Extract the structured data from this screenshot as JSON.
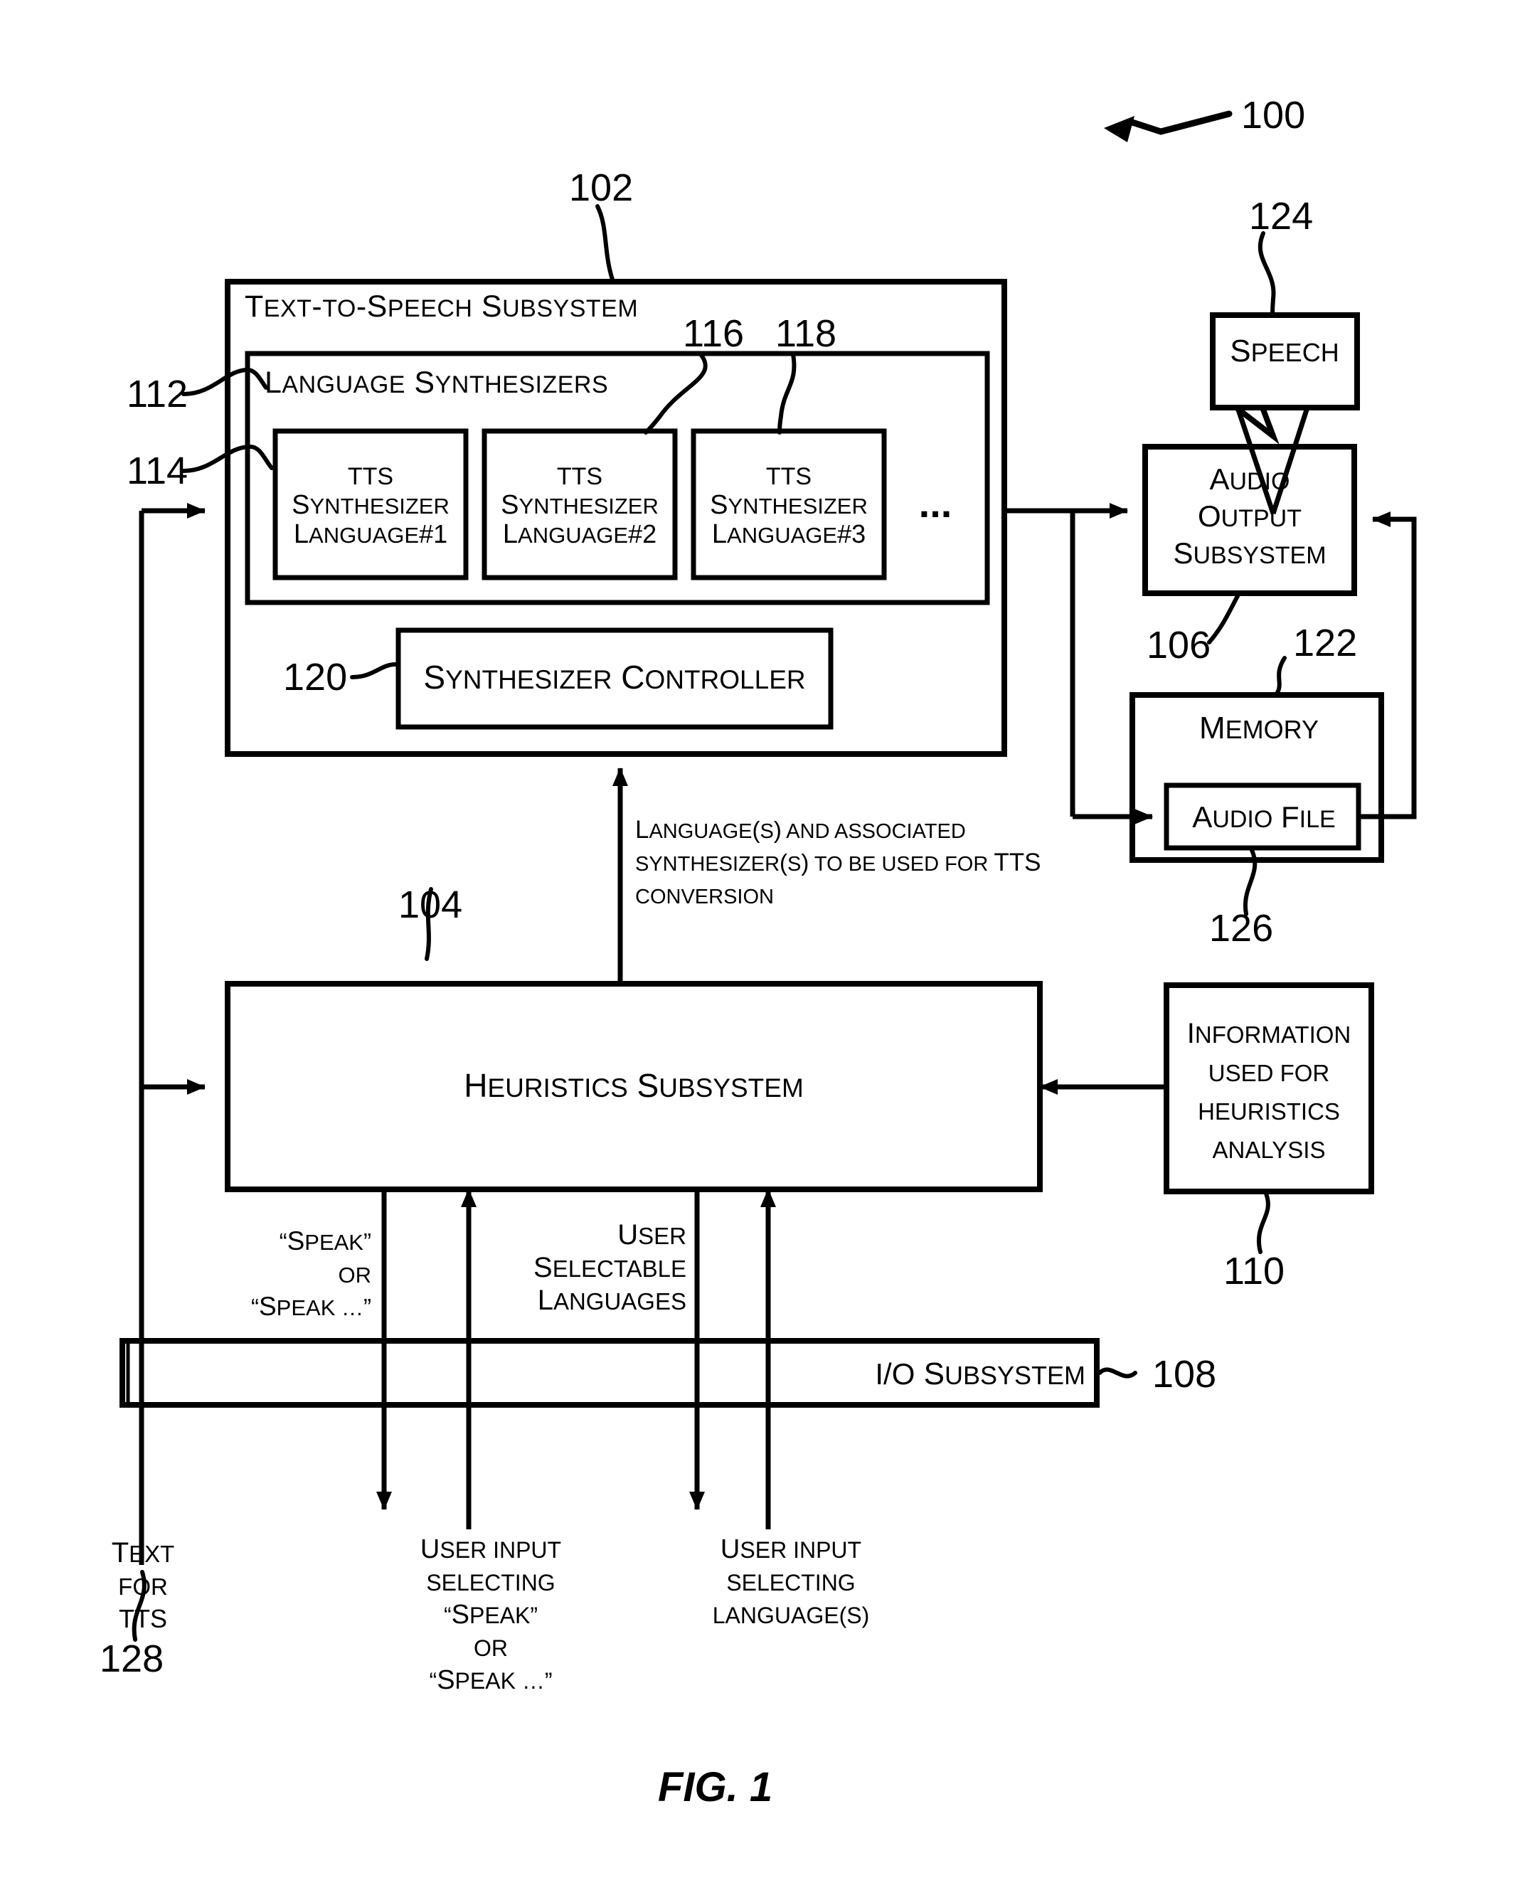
{
  "figure": {
    "caption": "FIG. 1",
    "system_ref": "100"
  },
  "refs": {
    "system": "100",
    "tts_subsystem": "102",
    "heuristics_subsystem": "104",
    "audio_output_subsystem": "106",
    "io_subsystem": "108",
    "heuristics_info": "110",
    "language_synthesizers": "112",
    "synth_lang1": "114",
    "synth_lang2": "116",
    "synth_lang3": "118",
    "synthesizer_controller": "120",
    "memory": "122",
    "speech": "124",
    "audio_file": "126",
    "text_for_tts": "128"
  },
  "boxes": {
    "tts_subsystem": {
      "title": "Text-to-Speech Subsystem"
    },
    "language_synthesizers": {
      "title": "Language Synthesizers"
    },
    "synthesizers": [
      {
        "line1": "TTS",
        "line2": "Synthesizer",
        "line3": "Language#1"
      },
      {
        "line1": "TTS",
        "line2": "Synthesizer",
        "line3": "Language#2"
      },
      {
        "line1": "TTS",
        "line2": "Synthesizer",
        "line3": "Language#3"
      }
    ],
    "ellipsis": "...",
    "synthesizer_controller": {
      "title": "Synthesizer Controller"
    },
    "heuristics_subsystem": {
      "title": "Heuristics Subsystem"
    },
    "audio_output_subsystem": {
      "line1": "Audio",
      "line2": "Output",
      "line3": "Subsystem"
    },
    "speech": {
      "title": "Speech"
    },
    "memory": {
      "title": "Memory"
    },
    "audio_file": {
      "title": "Audio File"
    },
    "heuristics_info": {
      "line1": "Information",
      "line2": "used for",
      "line3": "heuristics",
      "line4": "analysis"
    },
    "io_subsystem": {
      "title": "I/O Subsystem"
    }
  },
  "annotations": {
    "language_and_synth": {
      "line1": "Language(s) and associated",
      "line2": "synthesizer(s) to be used for TTS",
      "line3": "conversion"
    },
    "speak_or": {
      "line1": "“Speak”",
      "line2": "or",
      "line3": "“Speak …”"
    },
    "user_selectable_languages": {
      "line1": "User",
      "line2": "Selectable",
      "line3": "Languages"
    },
    "text_for_tts": {
      "line1": "Text",
      "line2": "for",
      "line3": "TTS"
    },
    "user_input_speak": {
      "line1": "User input",
      "line2": "selecting",
      "line3": "“Speak”",
      "line4": "or",
      "line5": "“Speak …”"
    },
    "user_input_language": {
      "line1": "User input",
      "line2": "selecting",
      "line3": "language(s)"
    }
  },
  "style": {
    "line_color": "#000000",
    "background": "#ffffff"
  }
}
